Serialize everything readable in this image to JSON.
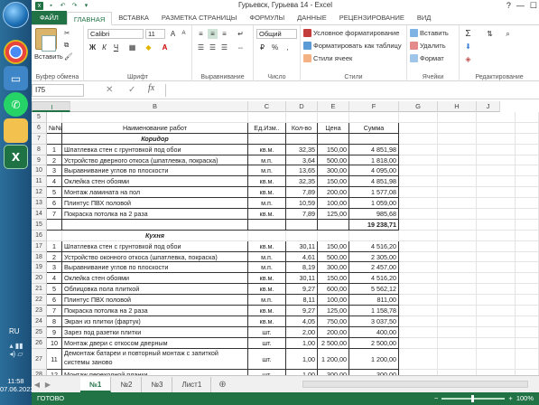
{
  "taskbar": {
    "lang": "RU",
    "time": "11:58",
    "date": "07.06.2023"
  },
  "app": {
    "title": "Гурьевск, Гурьева 14 - Excel",
    "help": "?",
    "window_buttons": [
      "—",
      "☐",
      "✕"
    ]
  },
  "tabs": [
    "ФАЙЛ",
    "ГЛАВНАЯ",
    "ВСТАВКА",
    "РАЗМЕТКА СТРАНИЦЫ",
    "ФОРМУЛЫ",
    "ДАННЫЕ",
    "РЕЦЕНЗИРОВАНИЕ",
    "ВИД"
  ],
  "active_tab": "ГЛАВНАЯ",
  "ribbon": {
    "clipboard": {
      "paste": "Вставить",
      "label": "Буфер обмена"
    },
    "font": {
      "name": "Calibri",
      "size": "11",
      "label": "Шрифт",
      "bold": "Ж",
      "italic": "К",
      "underline": "Ч",
      "grow": "A",
      "shrink": "A"
    },
    "align": {
      "label": "Выравнивание"
    },
    "number": {
      "format": "Общий",
      "percent": "%",
      "label": "Число"
    },
    "styles": {
      "conditional": "Условное форматирование",
      "table": "Форматировать как таблицу",
      "cell": "Стили ячеек",
      "label": "Стили"
    },
    "cells": {
      "insert": "Вставить",
      "delete": "Удалить",
      "format": "Формат",
      "label": "Ячейки"
    },
    "editing": {
      "sum": "Σ",
      "label": "Редактирование"
    }
  },
  "formula_bar": {
    "name_box": "I75",
    "cancel": "✕",
    "enter": "✓",
    "fx": "fx",
    "value": ""
  },
  "columns": [
    "A",
    "B",
    "C",
    "D",
    "E",
    "F",
    "G",
    "H",
    "I",
    "J"
  ],
  "selected_column": "I",
  "rows": [
    {
      "n": "5",
      "cells": [
        "",
        "",
        "",
        "",
        "",
        ""
      ]
    },
    {
      "n": "6",
      "cells": [
        "№№",
        "Наименование  работ",
        "Ед.Изм..",
        "Кол-во",
        "Цена",
        "Сумма"
      ],
      "hdr": true
    },
    {
      "n": "7",
      "cells": [
        "",
        "Коридор",
        "",
        "",
        "",
        ""
      ],
      "section": true
    },
    {
      "n": "8",
      "cells": [
        "1",
        "Шпатлевка стен с грунтовкой под обои",
        "кв.м.",
        "32,35",
        "150,00",
        "4 851,98"
      ]
    },
    {
      "n": "9",
      "cells": [
        "2",
        "Устройство дверного откоса (шпатлевка, покраска)",
        "м.п.",
        "3,64",
        "500,00",
        "1 818,00"
      ]
    },
    {
      "n": "10",
      "cells": [
        "3",
        "Выравнивание углов по плоскости",
        "м.п.",
        "13,65",
        "300,00",
        "4 095,00"
      ]
    },
    {
      "n": "11",
      "cells": [
        "4",
        "Оклейка стен обоями",
        "кв.м.",
        "32,35",
        "150,00",
        "4 851,98"
      ]
    },
    {
      "n": "12",
      "cells": [
        "5",
        "Монтаж ламината на пол",
        "кв.м.",
        "7,89",
        "200,00",
        "1 577,08"
      ]
    },
    {
      "n": "13",
      "cells": [
        "6",
        "Плинтус ПВХ половой",
        "м.п.",
        "10,59",
        "100,00",
        "1 059,00"
      ]
    },
    {
      "n": "14",
      "cells": [
        "7",
        "Покраска потолка на 2 раза",
        "кв.м.",
        "7,89",
        "125,00",
        "985,68"
      ]
    },
    {
      "n": "15",
      "cells": [
        "",
        "",
        "",
        "",
        "",
        "19 238,71"
      ],
      "total": true
    },
    {
      "n": "16",
      "cells": [
        "",
        "Кухня",
        "",
        "",
        "",
        ""
      ],
      "section": true,
      "plain": true
    },
    {
      "n": "17",
      "cells": [
        "1",
        "Шпатлевка стен с грунтовкой под обои",
        "кв.м.",
        "30,11",
        "150,00",
        "4 516,20"
      ]
    },
    {
      "n": "18",
      "cells": [
        "2",
        "Устройство оконного откоса (шпатлевка, покраска)",
        "м.п.",
        "4,61",
        "500,00",
        "2 305,00"
      ]
    },
    {
      "n": "19",
      "cells": [
        "3",
        "Выравнивание углов по плоскости",
        "м.п.",
        "8,19",
        "300,00",
        "2 457,00"
      ]
    },
    {
      "n": "20",
      "cells": [
        "4",
        "Оклейка стен обоями",
        "кв.м.",
        "30,11",
        "150,00",
        "4 516,20"
      ]
    },
    {
      "n": "21",
      "cells": [
        "5",
        "Облицовка пола плиткой",
        "кв.м.",
        "9,27",
        "600,00",
        "5 562,12"
      ]
    },
    {
      "n": "22",
      "cells": [
        "6",
        "Плинтус ПВХ половой",
        "м.п.",
        "8,11",
        "100,00",
        "811,00"
      ]
    },
    {
      "n": "23",
      "cells": [
        "7",
        "Покраска потолка на 2 раза",
        "кв.м.",
        "9,27",
        "125,00",
        "1 158,78"
      ]
    },
    {
      "n": "24",
      "cells": [
        "8",
        "Экран из плитки (фартук)",
        "кв.м.",
        "4,05",
        "750,00",
        "3 037,50"
      ]
    },
    {
      "n": "25",
      "cells": [
        "9",
        "Зарез под разетки плитки",
        "шт.",
        "2,00",
        "200,00",
        "400,00"
      ]
    },
    {
      "n": "26",
      "cells": [
        "10",
        "Монтаж двери с откосом дверным",
        "шт.",
        "1,00",
        "2 500,00",
        "2 500,00"
      ]
    },
    {
      "n": "27",
      "cells": [
        "11",
        "Демонтаж батареи и повторный монтаж с запиткой системы заново",
        "шт.",
        "1,00",
        "1 200,00",
        "1 200,00"
      ],
      "tall": true
    },
    {
      "n": "28",
      "cells": [
        "12",
        "Монтаж переходной планки",
        "шт.",
        "1,00",
        "300,00",
        "300,00"
      ]
    }
  ],
  "sheets": [
    "№1",
    "№2",
    "№3",
    "Лист1"
  ],
  "active_sheet": "№1",
  "add_sheet": "⊕",
  "status": {
    "ready": "ГОТОВО",
    "zoom": "100%",
    "minus": "−",
    "plus": "+"
  },
  "colors": {
    "excel_green": "#217346"
  }
}
